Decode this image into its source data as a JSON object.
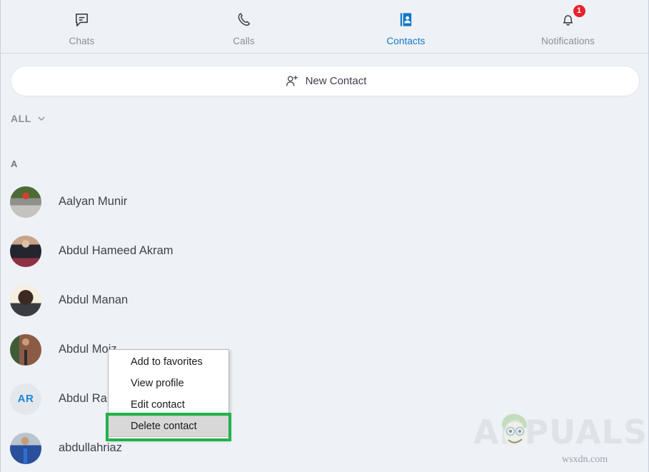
{
  "window": {
    "background_color": "#eef1f6",
    "accent_color": "#1277c9"
  },
  "topnav": {
    "items": [
      {
        "label": "Chats",
        "icon": "chat-bubble-icon",
        "active": false,
        "badge": null
      },
      {
        "label": "Calls",
        "icon": "phone-handset-icon",
        "active": false,
        "badge": null
      },
      {
        "label": "Contacts",
        "icon": "address-book-icon",
        "active": true,
        "badge": null
      },
      {
        "label": "Notifications",
        "icon": "bell-icon",
        "active": false,
        "badge": "1"
      }
    ]
  },
  "new_contact": {
    "label": "New Contact",
    "icon": "person-add-icon"
  },
  "filter": {
    "label": "ALL",
    "icon": "chevron-down-icon"
  },
  "section": {
    "letter": "A"
  },
  "contacts": [
    {
      "name": "Aalyan Munir",
      "avatar_type": "photo",
      "avatar_class": "ph1",
      "initials": ""
    },
    {
      "name": "Abdul Hameed Akram",
      "avatar_type": "photo",
      "avatar_class": "ph2",
      "initials": ""
    },
    {
      "name": "Abdul Manan",
      "avatar_type": "photo",
      "avatar_class": "ph3",
      "initials": ""
    },
    {
      "name": "Abdul Moiz",
      "avatar_type": "photo",
      "avatar_class": "ph4",
      "initials": ""
    },
    {
      "name": "Abdul Ra",
      "avatar_type": "initials",
      "avatar_class": "",
      "initials": "AR"
    },
    {
      "name": "abdullahriaz",
      "avatar_type": "photo",
      "avatar_class": "ph5",
      "initials": ""
    }
  ],
  "context_menu": {
    "items": [
      {
        "label": "Add to favorites",
        "selected": false
      },
      {
        "label": "View profile",
        "selected": false
      },
      {
        "label": "Edit contact",
        "selected": false
      },
      {
        "label": "Delete contact",
        "selected": true
      }
    ],
    "highlight_color": "#22b14c"
  },
  "watermark": {
    "brand": "APPUALS",
    "site": "wsxdn.com"
  }
}
